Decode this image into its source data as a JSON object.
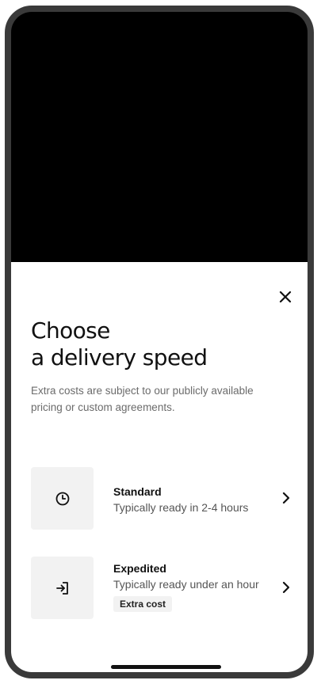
{
  "sheet": {
    "close_icon": "close-icon",
    "title_line1": "Choose",
    "title_line2": "a delivery speed",
    "subtitle": "Extra costs are subject to our publicly available pricing or custom agreements."
  },
  "options": [
    {
      "icon": "clock-icon",
      "title": "Standard",
      "description": "Typically ready in 2-4 hours"
    },
    {
      "icon": "sign-in-icon",
      "title": "Expedited",
      "description": "Typically ready under an hour",
      "badge": "Extra cost"
    }
  ],
  "colors": {
    "top_area": "#000000",
    "sheet_background": "#ffffff",
    "tile_background": "#f2f2f2",
    "text_primary": "#111111",
    "text_secondary": "#6b6b6b"
  }
}
